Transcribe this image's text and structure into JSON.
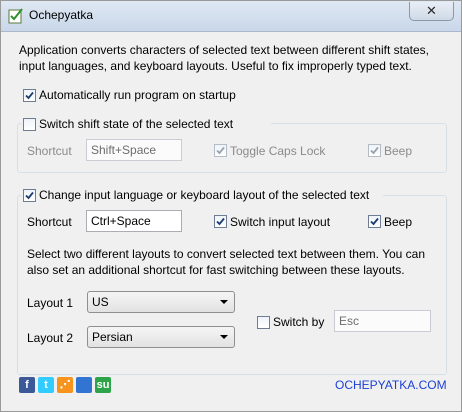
{
  "window": {
    "title": "Ochepyatka",
    "close_glyph": "✕"
  },
  "description": "Application converts characters of selected text between different shift states, input languages, and keyboard layouts. Useful to fix improperly typed text.",
  "autostart": {
    "label": "Automatically run program on startup",
    "checked": true
  },
  "shift_group": {
    "label": "Switch shift state of the selected text",
    "checked": false,
    "shortcut_label": "Shortcut",
    "shortcut_value": "Shift+Space",
    "toggle_caps_label": "Toggle Caps Lock",
    "toggle_caps_checked": true,
    "beep_label": "Beep",
    "beep_checked": true,
    "enabled": false
  },
  "layout_group": {
    "label": "Change input language or keyboard layout of the selected text",
    "checked": true,
    "shortcut_label": "Shortcut",
    "shortcut_value": "Ctrl+Space",
    "switch_input_label": "Switch input layout",
    "switch_input_checked": true,
    "beep_label": "Beep",
    "beep_checked": true,
    "info": "Select two different layouts to convert selected text between them. You can also set an additional shortcut for fast switching between these layouts.",
    "layout1_label": "Layout 1",
    "layout1_value": "US",
    "layout2_label": "Layout 2",
    "layout2_value": "Persian",
    "switch_by_label": "Switch by",
    "switch_by_checked": false,
    "switch_by_value": "Esc"
  },
  "footer": {
    "social": [
      {
        "name": "facebook-icon",
        "glyph": "f",
        "color": "#3b5998"
      },
      {
        "name": "twitter-icon",
        "glyph": "t",
        "color": "#33ccff"
      },
      {
        "name": "rss-icon",
        "glyph": "⋰",
        "color": "#f7941d"
      },
      {
        "name": "delicious-icon",
        "glyph": "",
        "color": "#3274d1"
      },
      {
        "name": "stumbleupon-icon",
        "glyph": "su",
        "color": "#2da44a"
      }
    ],
    "link": "OCHEPYATKA.COM"
  }
}
